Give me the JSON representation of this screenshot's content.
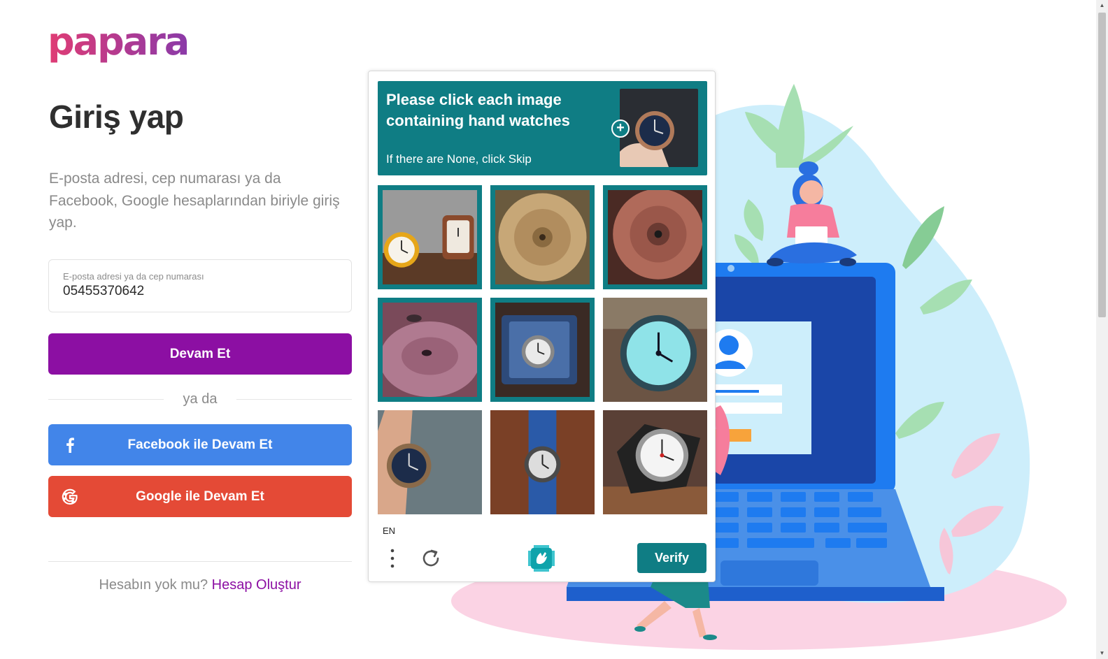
{
  "brand": {
    "logo_text": "papara"
  },
  "login": {
    "title": "Giriş yap",
    "subtitle": "E-posta adresi, cep numarası ya da Facebook, Google hesaplarından biriyle giriş yap.",
    "identifier_label": "E-posta adresi ya da cep numarası",
    "identifier_value": "05455370642",
    "continue_label": "Devam Et",
    "or_label": "ya da",
    "facebook_label": "Facebook ile Devam Et",
    "google_label": "Google ile Devam Et",
    "no_account_text": "Hesabın yok mu?",
    "create_account_link": "Hesap Oluştur"
  },
  "captcha": {
    "prompt": "Please click each image containing hand watches",
    "prompt_hint": "If there are None, click Skip",
    "language": "EN",
    "verify_label": "Verify",
    "tiles": [
      {
        "subject": "alarm-clocks",
        "selected": true
      },
      {
        "subject": "gold-disc",
        "selected": true
      },
      {
        "subject": "copper-disc",
        "selected": true
      },
      {
        "subject": "pink-disc",
        "selected": true
      },
      {
        "subject": "watch-in-box",
        "selected": true
      },
      {
        "subject": "teal-alarm-clock",
        "selected": false
      },
      {
        "subject": "watch-on-wrist",
        "selected": false
      },
      {
        "subject": "blue-strap-watch",
        "selected": false
      },
      {
        "subject": "silver-watch",
        "selected": false
      }
    ]
  },
  "colors": {
    "brand_purple": "#8c0fa3",
    "facebook_blue": "#4285e9",
    "google_red": "#e44a36",
    "captcha_teal": "#0f7d84"
  },
  "icons": {
    "facebook": "facebook-icon",
    "google": "google-icon",
    "menu": "more-vertical-icon",
    "refresh": "refresh-icon",
    "captcha_logo": "hcaptcha-logo-icon"
  }
}
